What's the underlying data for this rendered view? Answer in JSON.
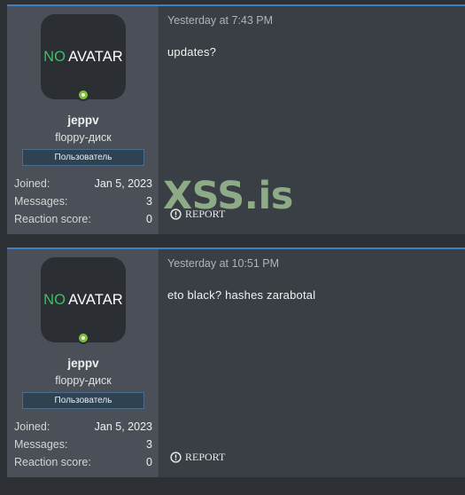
{
  "posts": [
    {
      "avatar": {
        "prefix": "NO",
        "text": "AVATAR"
      },
      "username": "jeppv",
      "user_title": "floppy-диск",
      "banner": "Пользователь",
      "stats": [
        {
          "label": "Joined:",
          "value": "Jan 5, 2023"
        },
        {
          "label": "Messages:",
          "value": "3"
        },
        {
          "label": "Reaction score:",
          "value": "0"
        }
      ],
      "time": "Yesterday at 7:43 PM",
      "message": "updates?",
      "report_label": "REPORT"
    },
    {
      "avatar": {
        "prefix": "NO",
        "text": "AVATAR"
      },
      "username": "jeppv",
      "user_title": "floppy-диск",
      "banner": "Пользователь",
      "stats": [
        {
          "label": "Joined:",
          "value": "Jan 5, 2023"
        },
        {
          "label": "Messages:",
          "value": "3"
        },
        {
          "label": "Reaction score:",
          "value": "0"
        }
      ],
      "time": "Yesterday at 10:51 PM",
      "message": "eto black? hashes zarabotal",
      "report_label": "REPORT"
    }
  ],
  "watermark": "XSS.is",
  "colors": {
    "accent": "#3f7fbf",
    "online": "#7fbf3f",
    "no_avatar": "#3fbf6a"
  }
}
